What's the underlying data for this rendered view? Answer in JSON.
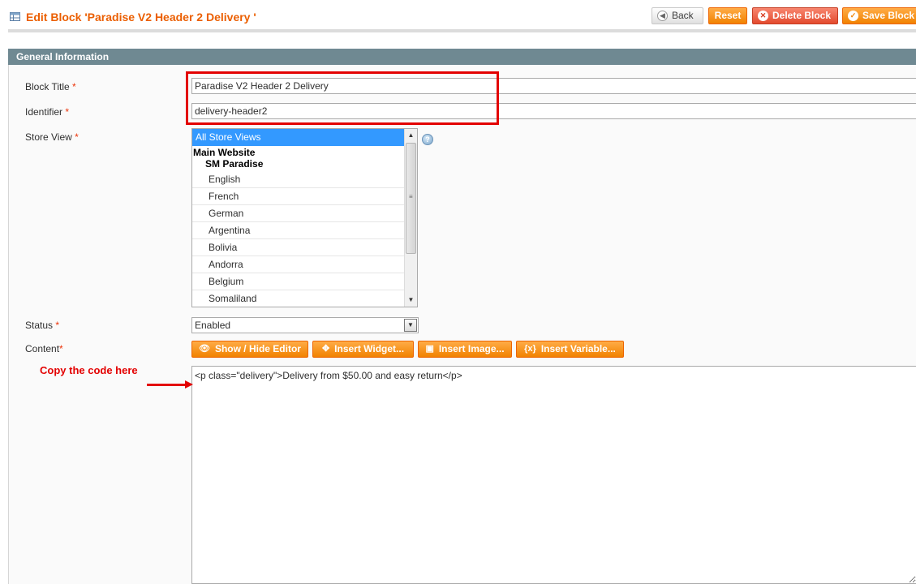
{
  "header": {
    "title": "Edit Block 'Paradise V2 Header 2 Delivery '",
    "buttons": {
      "back": "Back",
      "reset": "Reset",
      "delete": "Delete Block",
      "save": "Save Block"
    }
  },
  "section": {
    "title": "General Information"
  },
  "form": {
    "block_title": {
      "label": "Block Title",
      "required": "*",
      "value": "Paradise V2 Header 2 Delivery"
    },
    "identifier": {
      "label": "Identifier",
      "required": "*",
      "value": "delivery-header2"
    },
    "store_view": {
      "label": "Store View",
      "required": "*",
      "selected": "All Store Views",
      "group_website": "Main Website",
      "group_store": "SM Paradise",
      "options": [
        "English",
        "French",
        "German",
        "Argentina",
        "Bolivia",
        "Andorra",
        "Belgium",
        "Somaliland"
      ]
    },
    "status": {
      "label": "Status",
      "required": "*",
      "value": "Enabled"
    },
    "content": {
      "label": "Content",
      "required": "*",
      "value": "<p class=\"delivery\">Delivery from $50.00 and easy return</p>"
    }
  },
  "editor_buttons": {
    "show_hide": "Show / Hide Editor",
    "insert_widget": "Insert Widget...",
    "insert_image": "Insert Image...",
    "insert_variable": "Insert Variable..."
  },
  "annotation": {
    "text": "Copy the code here",
    "highlight_color": "#e30000"
  },
  "colors": {
    "accent": "#eb5e00",
    "button_orange": "#f18200",
    "section_bar": "#6f8992",
    "selected_option": "#3399ff"
  }
}
